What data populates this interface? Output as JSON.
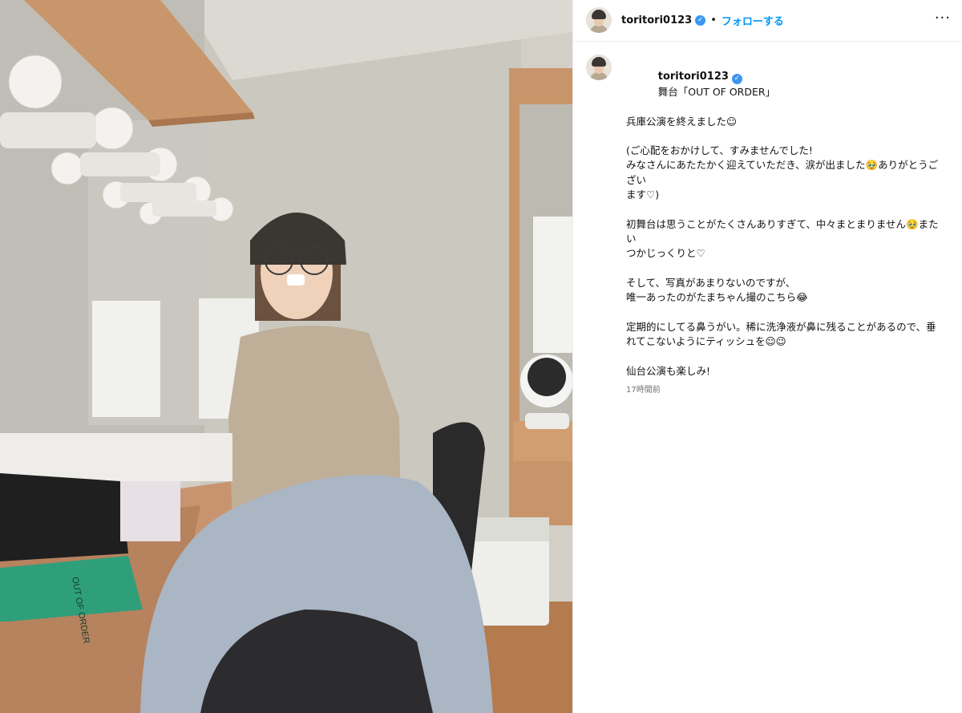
{
  "post": {
    "username": "toritori0123",
    "separator": "•",
    "follow_label": "フォローする",
    "more_label": "···"
  },
  "caption": {
    "first_line": "舞台「OUT OF ORDER」",
    "paragraphs": [
      [
        "兵庫公演を終えました☺︎"
      ],
      [
        "(ご心配をおかけして、すみませんでした!",
        "みなさんにあたたかく迎えていただき、涙が出ました🥹ありがとうござい",
        "ます♡)"
      ],
      [
        "初舞台は思うことがたくさんありすぎて、中々まとまりません🥹またい",
        "つかじっくりと♡"
      ],
      [
        "そして、写真があまりないのですが、",
        "唯一あったのがたまちゃん撮のこちら😂"
      ],
      [
        "定期的にしてる鼻うがい。稀に洗浄液が鼻に残ることがあるので、垂",
        "れてこないようにティッシュを☺︎😉"
      ],
      [
        "仙台公演も楽しみ!"
      ]
    ],
    "time": "17時間前"
  },
  "photo": {
    "book_title": "OUT OF ORDER"
  }
}
